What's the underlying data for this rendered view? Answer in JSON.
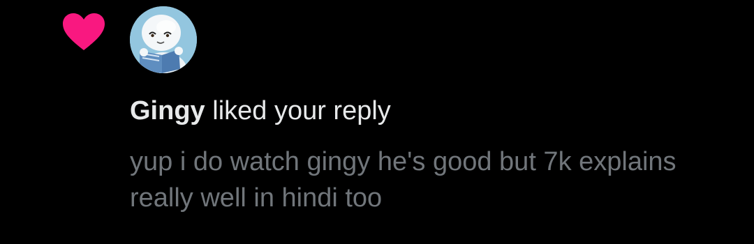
{
  "notification": {
    "type_icon": "heart-icon",
    "actor": {
      "avatar": "avatar-cartoon-reading-book",
      "name": "Gingy"
    },
    "action_text": " liked your reply",
    "reply_text": "yup i do watch gingy he's good but 7k explains really well in hindi too"
  },
  "colors": {
    "background": "#000000",
    "heart": "#f91880",
    "primary_text": "#e7e9ea",
    "secondary_text": "#71767b"
  }
}
